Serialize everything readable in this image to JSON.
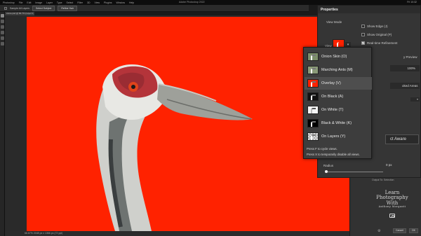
{
  "app": {
    "menu": [
      "Photoshop",
      "File",
      "Edit",
      "Image",
      "Layer",
      "Type",
      "Select",
      "Filter",
      "3D",
      "View",
      "Plugins",
      "Window",
      "Help"
    ],
    "window_title": "Adobe Photoshop 2022",
    "clock": "Fri 10:32"
  },
  "options_bar": {
    "sample_label": "Sample All Layers",
    "select_subject": "Select Subject",
    "refine_hair": "Refine Hair"
  },
  "document": {
    "tab": "crane.psd @ 66.7% (Layer 0, RGB/8)",
    "status": "66.67%    2048 px x 1366 px (72 ppi)",
    "canvas_color": "#ff2200"
  },
  "properties": {
    "title": "Properties",
    "view_mode_label": "View Mode",
    "view_label": "View",
    "dropdown_arrow": "▾",
    "show_edge": "Show Edge (J)",
    "show_original": "Show Original (P)",
    "realtime": "Real-time Refinement",
    "realtime_checked": "✓",
    "preview_fragment": "y Preview",
    "opacity": "100%",
    "areas_fragment": "oked Areas",
    "aware_fragment": "ct Aware",
    "radius_label": "Radius",
    "radius_value": "0 px",
    "output_label": "Output To: Selection"
  },
  "view_menu": {
    "items": [
      {
        "label": "Onion Skin (O)",
        "thumb": "onion",
        "selected": false
      },
      {
        "label": "Marching Ants (M)",
        "thumb": "ants",
        "selected": false
      },
      {
        "label": "Overlay (V)",
        "thumb": "overlay",
        "selected": true
      },
      {
        "label": "On Black (A)",
        "thumb": "black",
        "selected": false
      },
      {
        "label": "On White (T)",
        "thumb": "white",
        "selected": false
      },
      {
        "label": "Black & White (K)",
        "thumb": "bw",
        "selected": false
      },
      {
        "label": "On Layers (Y)",
        "thumb": "layers",
        "selected": false
      }
    ],
    "hint1": "Press F to cycle views.",
    "hint2": "Press X to temporarily disable all views."
  },
  "watermark": {
    "line1": "Learn",
    "line2": "Photography",
    "line3": "With",
    "line4": "Anthony Morganti",
    "logo": "camera-icon"
  },
  "bottom_buttons": {
    "cancel": "Cancel",
    "ok": "OK"
  }
}
